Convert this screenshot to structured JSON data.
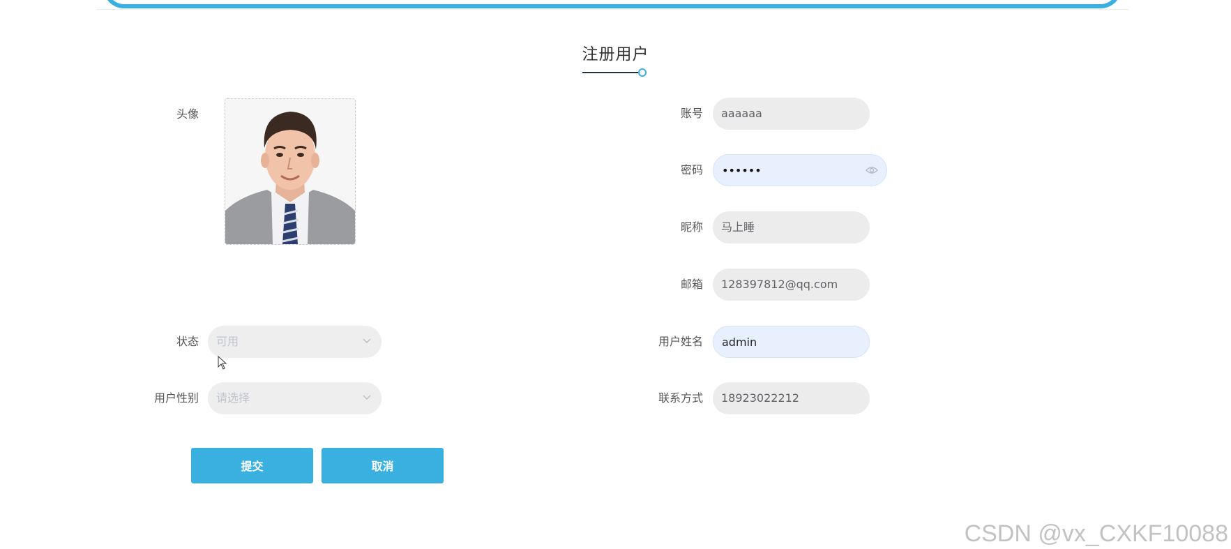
{
  "form": {
    "title": "注册用户",
    "fields": {
      "avatar": {
        "label": "头像"
      },
      "account": {
        "label": "账号",
        "value": "aaaaaa"
      },
      "password": {
        "label": "密码",
        "value": "••••••"
      },
      "nickname": {
        "label": "昵称",
        "value": "马上睡"
      },
      "email": {
        "label": "邮箱",
        "value": "128397812@qq.com"
      },
      "status": {
        "label": "状态",
        "value": "可用"
      },
      "realname": {
        "label": "用户姓名",
        "value": "admin"
      },
      "gender": {
        "label": "用户性别",
        "placeholder": "请选择"
      },
      "phone": {
        "label": "联系方式",
        "value": "18923022212"
      }
    },
    "buttons": {
      "submit": "提交",
      "cancel": "取消"
    }
  },
  "watermark": "CSDN @vx_CXKF10088",
  "colors": {
    "accent": "#39b0e0",
    "input_bg": "#ececec",
    "focused_bg": "#e8f0fe"
  },
  "icons": {
    "password_toggle": "eye-icon",
    "select_arrow": "chevron-down-icon"
  }
}
